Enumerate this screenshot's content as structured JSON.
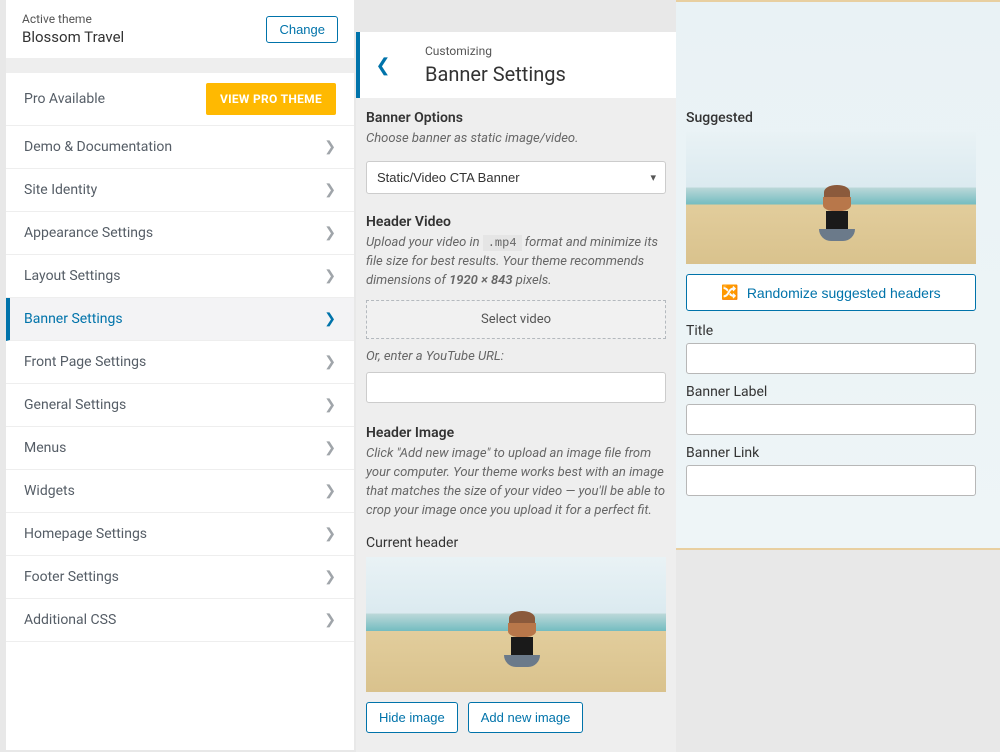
{
  "sidebar": {
    "active_theme_label": "Active theme",
    "theme_name": "Blossom Travel",
    "change_label": "Change",
    "pro_label": "Pro Available",
    "view_pro_label": "VIEW PRO THEME",
    "items": [
      {
        "label": "Demo & Documentation"
      },
      {
        "label": "Site Identity"
      },
      {
        "label": "Appearance Settings"
      },
      {
        "label": "Layout Settings"
      },
      {
        "label": "Banner Settings",
        "active": true
      },
      {
        "label": "Front Page Settings"
      },
      {
        "label": "General Settings"
      },
      {
        "label": "Menus"
      },
      {
        "label": "Widgets"
      },
      {
        "label": "Homepage Settings"
      },
      {
        "label": "Footer Settings"
      },
      {
        "label": "Additional CSS"
      }
    ]
  },
  "middle": {
    "crumb": "Customizing",
    "title": "Banner Settings",
    "banner_options": {
      "title": "Banner Options",
      "desc": "Choose banner as static image/video.",
      "selected": "Static/Video CTA Banner"
    },
    "header_video": {
      "title": "Header Video",
      "desc_pre": "Upload your video in ",
      "code": ".mp4",
      "desc_mid": " format and minimize its file size for best results. Your theme recommends dimensions of ",
      "dims": "1920 × 843",
      "desc_post": " pixels.",
      "select_video": "Select video",
      "or_label": "Or, enter a YouTube URL:"
    },
    "header_image": {
      "title": "Header Image",
      "desc": "Click \"Add new image\" to upload an image file from your computer. Your theme works best with an image that matches the size of your video — you'll be able to crop your image once you upload it for a perfect fit.",
      "current_label": "Current header",
      "hide_label": "Hide image",
      "add_label": "Add new image"
    }
  },
  "right": {
    "suggested_label": "Suggested",
    "randomize_label": "Randomize suggested headers",
    "title_label": "Title",
    "banner_label_label": "Banner Label",
    "banner_link_label": "Banner Link"
  }
}
